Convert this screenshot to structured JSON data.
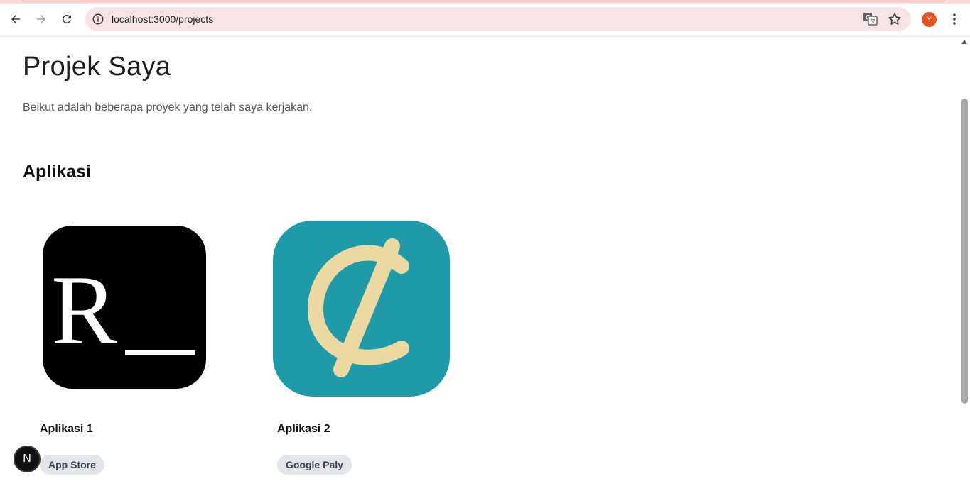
{
  "browser": {
    "url": "localhost:3000/projects",
    "profile_initial": "Y",
    "icons": {
      "back": "arrow-left-icon",
      "forward": "arrow-right-icon",
      "reload": "reload-icon",
      "site_info": "info-icon",
      "translate": "translate-icon",
      "bookmark": "star-icon",
      "menu": "kebab-menu-icon"
    },
    "colors": {
      "omnibox_bg": "#f6e4e6",
      "avatar_bg": "#e8531f"
    }
  },
  "page": {
    "title": "Projek Saya",
    "subtitle": "Beikut adalah beberapa proyek yang telah saya kerjakan.",
    "section_title": "Aplikasi",
    "apps": [
      {
        "name": "Aplikasi 1",
        "store": "App Store",
        "icon": "r-terminal-icon",
        "icon_bg": "#000000"
      },
      {
        "name": "Aplikasi 2",
        "store": "Google Paly",
        "icon": "cent-sign-icon",
        "icon_bg": "#1f9aa8"
      }
    ]
  },
  "dev_badge": {
    "label": "N"
  }
}
